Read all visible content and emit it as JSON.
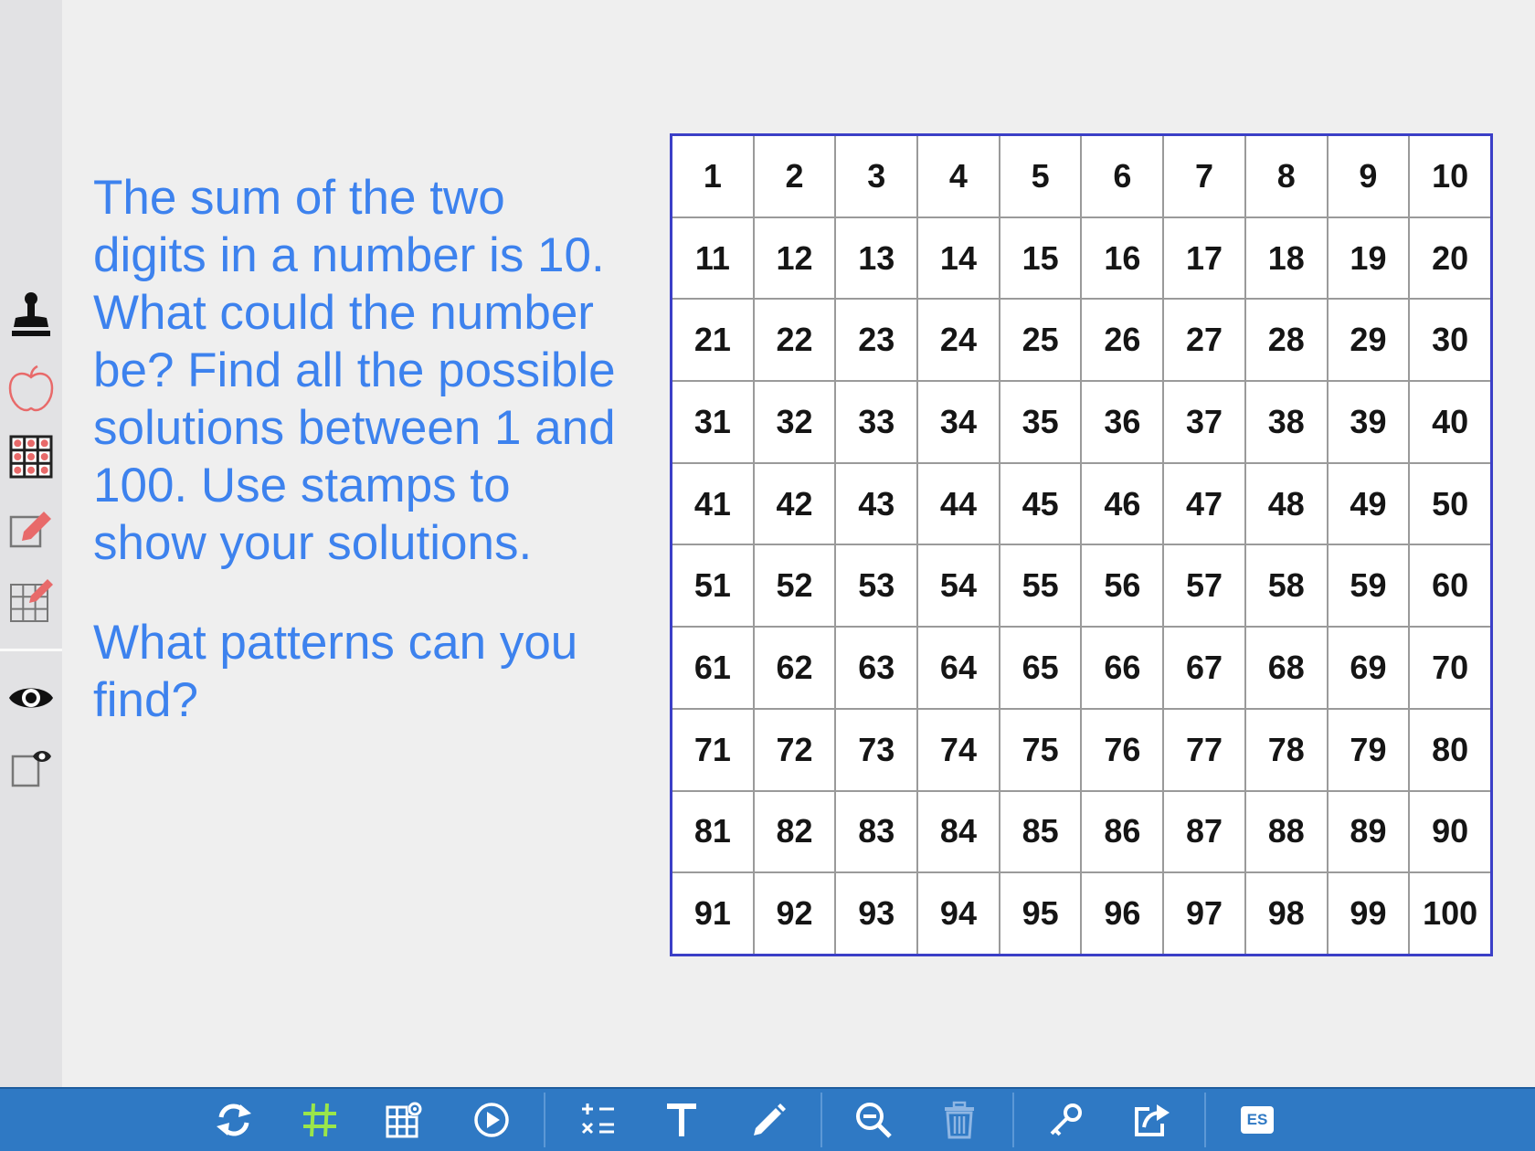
{
  "prompt": {
    "paragraph1": "The sum of the two digits in a number is 10. What could the number be? Find all the possible solutions between 1 and 100. Use stamps to show your solutions.",
    "paragraph2": "What patterns can you find?",
    "color": "#3d82ee"
  },
  "hundred_chart": {
    "border_color": "#3b3fc7",
    "cells": [
      "1",
      "2",
      "3",
      "4",
      "5",
      "6",
      "7",
      "8",
      "9",
      "10",
      "11",
      "12",
      "13",
      "14",
      "15",
      "16",
      "17",
      "18",
      "19",
      "20",
      "21",
      "22",
      "23",
      "24",
      "25",
      "26",
      "27",
      "28",
      "29",
      "30",
      "31",
      "32",
      "33",
      "34",
      "35",
      "36",
      "37",
      "38",
      "39",
      "40",
      "41",
      "42",
      "43",
      "44",
      "45",
      "46",
      "47",
      "48",
      "49",
      "50",
      "51",
      "52",
      "53",
      "54",
      "55",
      "56",
      "57",
      "58",
      "59",
      "60",
      "61",
      "62",
      "63",
      "64",
      "65",
      "66",
      "67",
      "68",
      "69",
      "70",
      "71",
      "72",
      "73",
      "74",
      "75",
      "76",
      "77",
      "78",
      "79",
      "80",
      "81",
      "82",
      "83",
      "84",
      "85",
      "86",
      "87",
      "88",
      "89",
      "90",
      "91",
      "92",
      "93",
      "94",
      "95",
      "96",
      "97",
      "98",
      "99",
      "100"
    ]
  },
  "sidebar": {
    "tools": [
      "stamp-icon",
      "apple-icon",
      "grid-stamp-icon",
      "edit-box-icon",
      "edit-grid-icon",
      "eye-icon",
      "box-eye-icon"
    ]
  },
  "toolbar": {
    "color": "#2f79c4",
    "buttons": [
      "refresh-icon",
      "hash-grid-icon",
      "grid-settings-icon",
      "play-icon",
      "operations-icon",
      "text-icon",
      "pencil-icon",
      "zoom-out-icon",
      "trash-icon",
      "key-icon",
      "share-icon"
    ],
    "language_badge": "ES"
  }
}
